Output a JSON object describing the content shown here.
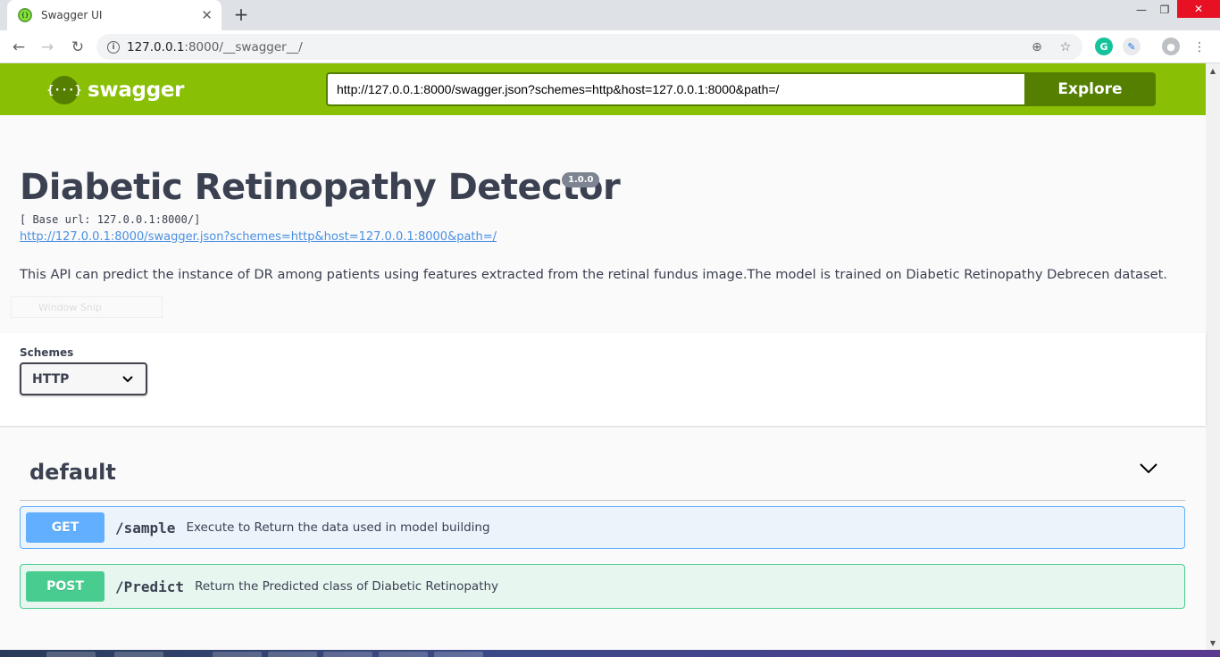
{
  "browser": {
    "tab_title": "Swagger UI",
    "tab_close": "✕",
    "new_tab": "+",
    "url_host": "127.0.0.1",
    "url_path": ":8000/__swagger__/",
    "controls": {
      "minimize": "—",
      "restore": "❐",
      "close": "✕"
    },
    "icons": [
      "back-arrow-icon",
      "forward-arrow-icon",
      "reload-icon",
      "info-icon",
      "zoom-icon",
      "star-icon",
      "grammarly-icon",
      "extension-icon",
      "profile-icon",
      "menu-icon"
    ]
  },
  "topbar": {
    "logo_text": "swagger",
    "logo_mark": "{···}",
    "explore_url": "http://127.0.0.1:8000/swagger.json?schemes=http&host=127.0.0.1:8000&path=/",
    "explore_label": "Explore",
    "color": "#89bf04"
  },
  "info": {
    "title": "Diabetic Retinopathy Detector",
    "version": "1.0.0",
    "base_url": "[ Base url: 127.0.0.1:8000/]",
    "spec_link": "http://127.0.0.1:8000/swagger.json?schemes=http&host=127.0.0.1:8000&path=/",
    "description": "This API can predict the instance of DR among patients using features extracted from the retinal fundus image.The model is trained on Diabetic Retinopathy Debrecen dataset.",
    "ghost_text": "Window Snip"
  },
  "schemes": {
    "label": "Schemes",
    "selected": "HTTP"
  },
  "tag": {
    "name": "default"
  },
  "operations": [
    {
      "method": "GET",
      "path": "/sample",
      "summary": "Execute to Return the data used in model building",
      "color": "#61affe"
    },
    {
      "method": "POST",
      "path": "/Predict",
      "summary": "Return the Predicted class of Diabetic Retinopathy",
      "color": "#49cc90"
    }
  ]
}
